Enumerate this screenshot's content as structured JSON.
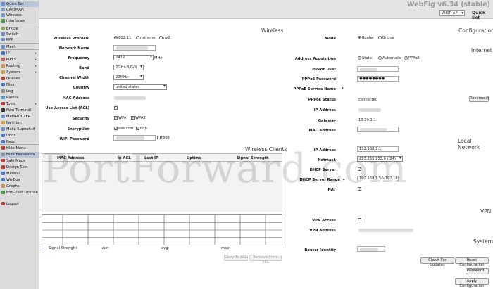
{
  "app": {
    "title": "WebFig v6.34 (stable)",
    "mode": "WISP AP",
    "view": "Quick Set"
  },
  "sidebar": {
    "items": [
      {
        "label": "Quick Set",
        "icon": "quickset-icon",
        "color": "#6a8fc8",
        "selected": true
      },
      {
        "label": "CAPsMAN",
        "icon": "capsman-icon",
        "color": "#7aa0d0"
      },
      {
        "label": "Wireless",
        "icon": "wireless-icon",
        "color": "#6a9ad0"
      },
      {
        "label": "Interfaces",
        "icon": "interfaces-icon",
        "color": "#4a9a4a"
      },
      {
        "label": "Bridge",
        "icon": "bridge-icon",
        "color": "#8aa860"
      },
      {
        "label": "Switch",
        "icon": "switch-icon",
        "color": "#6a8fc8"
      },
      {
        "label": "PPP",
        "icon": "ppp-icon",
        "color": "#6a8fc8"
      },
      {
        "label": "Mesh",
        "icon": "mesh-icon",
        "color": "#6a8fc8"
      },
      {
        "label": "IP",
        "icon": "ip-icon",
        "color": "#4a7ad0",
        "arrow": true
      },
      {
        "label": "MPLS",
        "icon": "mpls-icon",
        "color": "#c86060",
        "arrow": true
      },
      {
        "label": "Routing",
        "icon": "routing-icon",
        "color": "#d09050",
        "arrow": true
      },
      {
        "label": "System",
        "icon": "system-icon",
        "color": "#d0a040",
        "arrow": true
      },
      {
        "label": "Queues",
        "icon": "queues-icon",
        "color": "#c04040"
      },
      {
        "label": "Files",
        "icon": "files-icon",
        "color": "#4a7ad0"
      },
      {
        "label": "Log",
        "icon": "log-icon",
        "color": "#909090"
      },
      {
        "label": "Radius",
        "icon": "radius-icon",
        "color": "#4a9ad0"
      },
      {
        "label": "Tools",
        "icon": "tools-icon",
        "color": "#c04040",
        "arrow": true
      },
      {
        "label": "New Terminal",
        "icon": "terminal-icon",
        "color": "#303030"
      },
      {
        "label": "MetaROUTER",
        "icon": "metarouter-icon",
        "color": "#6a8fc8"
      },
      {
        "label": "Partition",
        "icon": "partition-icon",
        "color": "#d0a040"
      },
      {
        "label": "Make Supout.rif",
        "icon": "supout-icon",
        "color": "#6a8fc8"
      },
      {
        "label": "Undo",
        "icon": "undo-icon",
        "color": "#4a7ad0"
      },
      {
        "label": "Redo",
        "icon": "redo-icon",
        "color": "#4a7ad0"
      },
      {
        "label": "Hide Menu",
        "icon": "hide-menu-icon",
        "color": "#c04040"
      },
      {
        "label": "Hide Passwords",
        "icon": "hide-passwords-icon",
        "color": "#909090",
        "selected": true
      },
      {
        "label": "Safe Mode",
        "icon": "safe-mode-icon",
        "color": "#c04040"
      },
      {
        "label": "Design Skin",
        "icon": "design-skin-icon",
        "color": "#c04040"
      },
      {
        "label": "Manual",
        "icon": "manual-icon",
        "color": "#4a7ad0"
      },
      {
        "label": "WinBox",
        "icon": "winbox-icon",
        "color": "#4a7ad0"
      },
      {
        "label": "Graphs",
        "icon": "graphs-icon",
        "color": "#d09050"
      },
      {
        "label": "End-User License",
        "icon": "license-icon",
        "color": "#4a9a4a"
      },
      {
        "label": "Logout",
        "icon": "logout-icon",
        "color": "#c04040"
      }
    ]
  },
  "wireless": {
    "section": "Wireless",
    "protocol_label": "Wireless Protocol",
    "protocol_options": [
      "802.11",
      "nstreme",
      "nv2"
    ],
    "network_name_label": "Network Name",
    "frequency_label": "Frequency",
    "frequency_value": "2412",
    "frequency_unit": "MHz",
    "band_label": "Band",
    "band_value": "2GHz-B/G/N",
    "channel_width_label": "Channel Width",
    "channel_width_value": "20MHz",
    "country_label": "Country",
    "country_value": "united states",
    "mac_label": "MAC Address",
    "acl_label": "Use Access List (ACL)",
    "security_label": "Security",
    "security_wpa": "WPA",
    "security_wpa2": "WPA2",
    "encryption_label": "Encryption",
    "encryption_aes": "aes ccm",
    "encryption_tkip": "tkip",
    "wifi_password_label": "WiFi Password",
    "hide_label": "Hide"
  },
  "clients": {
    "section": "Wireless Clients",
    "columns": [
      "MAC Address",
      "In ACL",
      "Last IP",
      "Uptime",
      "Signal Strength"
    ],
    "legend": [
      "Signal Strength",
      "cur:",
      "avg:",
      "max:"
    ],
    "copy_acl": "Copy To ACL",
    "remove_acl": "Remove From ACL"
  },
  "configuration": {
    "section": "Configuration",
    "mode_label": "Mode",
    "mode_options": [
      "Router",
      "Bridge"
    ]
  },
  "internet": {
    "section": "Internet",
    "acq_label": "Address Acquisition",
    "acq_options": [
      "Static",
      "Automatic",
      "PPPoE"
    ],
    "user_label": "PPPoE User",
    "password_label": "PPPoE Password",
    "password_value": "●●●●●●●●",
    "service_label": "PPPoE Service Name",
    "status_label": "PPPoE Status",
    "status_value": "connected",
    "reconnect": "Reconnect",
    "ip_label": "IP Address",
    "gateway_label": "Gateway",
    "gateway_value": "10.19.1.1",
    "mac_label": "MAC Address"
  },
  "local": {
    "section": "Local Network",
    "ip_label": "IP Address",
    "ip_value": "192.168.1.1",
    "netmask_label": "Netmask",
    "netmask_value": "255.255.255.0 (/24)",
    "dhcp_label": "DHCP Server",
    "dhcp_range_label": "DHCP Server Range",
    "dhcp_range_value": "192.168.1.50-192.168.1",
    "nat_label": "NAT"
  },
  "vpn": {
    "section": "VPN",
    "access_label": "VPN Access",
    "address_label": "VPN Address"
  },
  "system": {
    "section": "System",
    "identity_label": "Router Identity",
    "check_updates": "Check For Updates",
    "reset_config": "Reset Configuration",
    "password": "Password...",
    "apply": "Apply Configuration"
  },
  "watermark": "PortForward.com"
}
